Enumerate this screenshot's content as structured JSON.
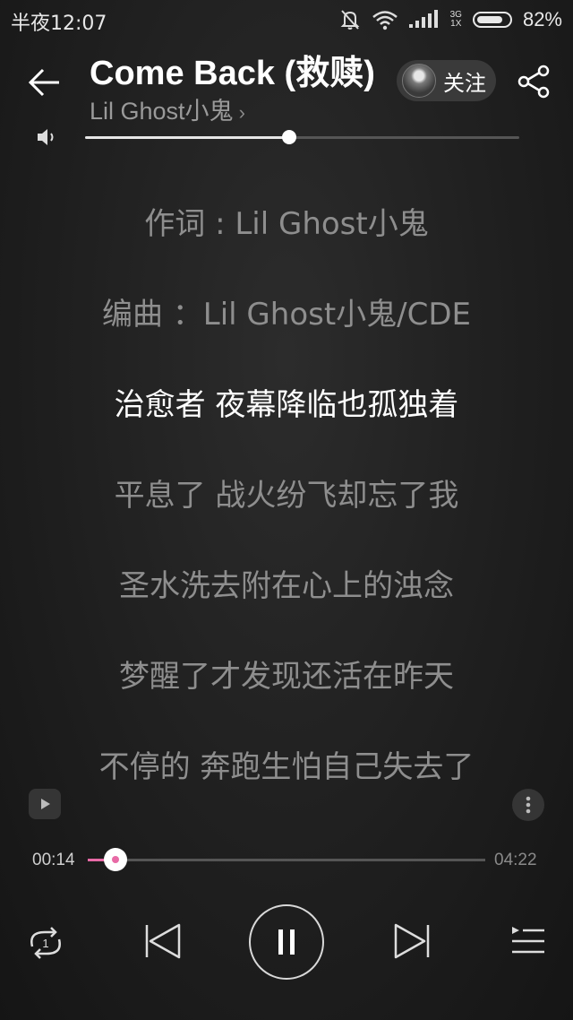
{
  "status_bar": {
    "time": "半夜12:07",
    "network_top": "3G",
    "network_bottom": "1X",
    "battery_percent_text": "82%",
    "battery_level": 0.82
  },
  "header": {
    "title": "Come Back (救赎)",
    "artist": "Lil Ghost小鬼",
    "artist_chevron": "›",
    "follow_label": "关注"
  },
  "volume": {
    "level": 0.47
  },
  "lyrics": [
    "作词 : Lil Ghost小鬼",
    "编曲 ：Lil Ghost小鬼/CDE",
    "治愈者 夜幕降临也孤独着",
    "平息了 战火纷飞却忘了我",
    "圣水洗去附在心上的浊念",
    "梦醒了才发现还活在昨天",
    "不停的 奔跑生怕自己失去了"
  ],
  "active_lyric_index": 2,
  "progress": {
    "current": "00:14",
    "total": "04:22",
    "fraction": 0.07
  },
  "colors": {
    "accent": "#e86aa6",
    "background": "#1f1f1f",
    "lyric_inactive": "#8e8e8e",
    "lyric_active": "#ffffff"
  },
  "icons": {
    "back": "arrow-left-icon",
    "share": "share-icon",
    "volume": "speaker-icon",
    "repeat": "repeat-one-icon",
    "prev": "skip-previous-icon",
    "pause": "pause-icon",
    "next": "skip-next-icon",
    "queue": "playlist-icon"
  }
}
